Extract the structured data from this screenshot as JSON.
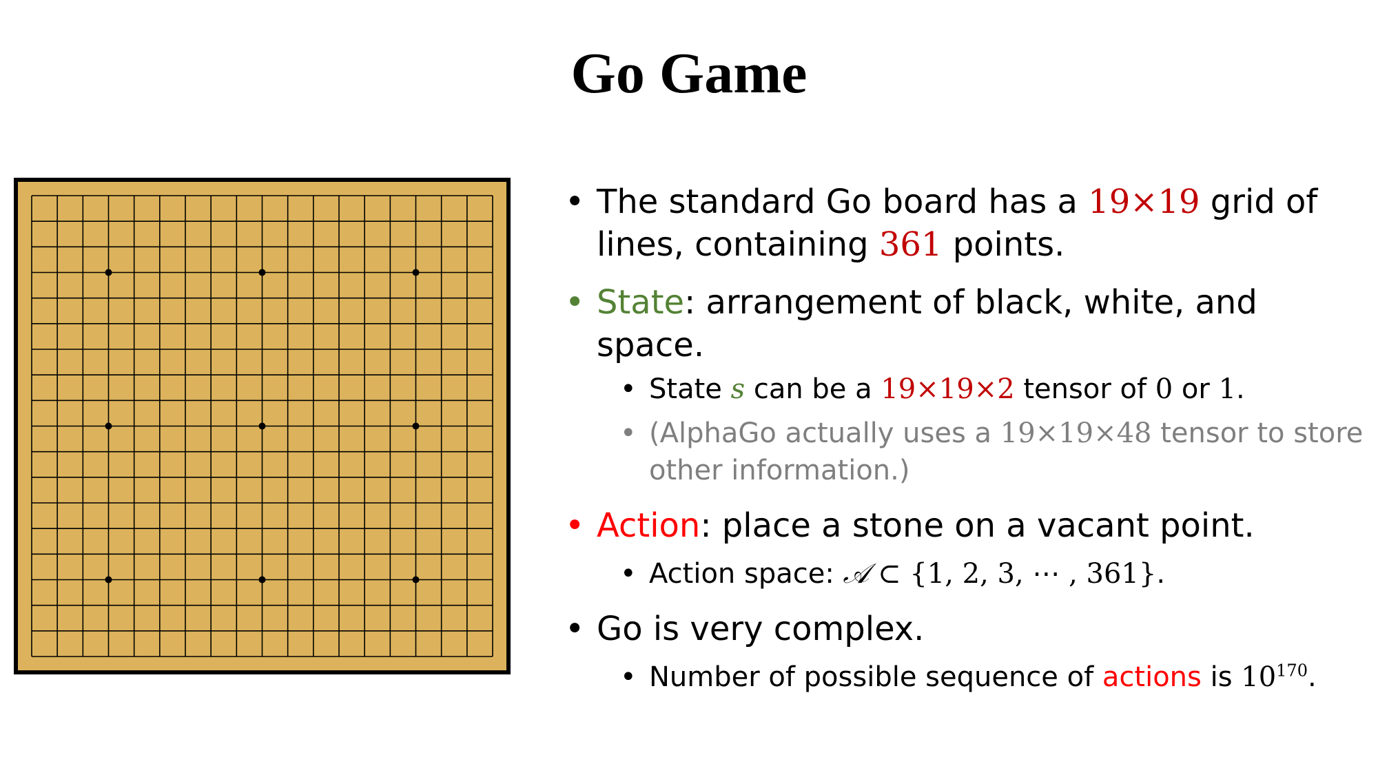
{
  "title": "Go Game",
  "colors": {
    "board": "#dcb35c",
    "frame": "#000000",
    "number_red": "#c00000",
    "action_red": "#ff0000",
    "state_green": "#548235",
    "gray_text": "#7f7f7f"
  },
  "board": {
    "lines": 19,
    "star_points": [
      [
        3,
        3
      ],
      [
        3,
        9
      ],
      [
        3,
        15
      ],
      [
        9,
        3
      ],
      [
        9,
        9
      ],
      [
        9,
        15
      ],
      [
        15,
        3
      ],
      [
        15,
        9
      ],
      [
        15,
        15
      ]
    ]
  },
  "bullets": {
    "b1": {
      "marker": "•",
      "t1": "The standard Go board has a ",
      "n1": "19×19",
      "t2": " grid of lines, containing ",
      "n2": "361",
      "t3": " points."
    },
    "b2": {
      "marker": "•",
      "label": "State",
      "rest": ": arrangement of black, white, and space."
    },
    "b2a": {
      "marker": "•",
      "t1": "State ",
      "var": "s",
      "t2": " can be a ",
      "n1": "19×19×2",
      "t3": " tensor of ",
      "n2": "0",
      "t4": " or ",
      "n3": "1",
      "t5": "."
    },
    "b2b": {
      "marker": "•",
      "t1": "(AlphaGo actually uses a ",
      "n1": "19×19×48",
      "t2": " tensor to store other information.)"
    },
    "b3": {
      "marker": "•",
      "label": "Action",
      "rest": ": place a stone on a vacant point."
    },
    "b3a": {
      "marker": "•",
      "t1": "Action space: ",
      "symbol": "𝒜",
      "math": " ⊂ {1, 2, 3,  ⋯ , 361}",
      "t2": "."
    },
    "b4": {
      "marker": "•",
      "text": "Go is very complex."
    },
    "b4a": {
      "marker": "•",
      "t1": "Number of possible sequence of ",
      "red": "actions",
      "t2": " is  ",
      "base": "10",
      "exp": "170",
      "t3": "."
    }
  }
}
